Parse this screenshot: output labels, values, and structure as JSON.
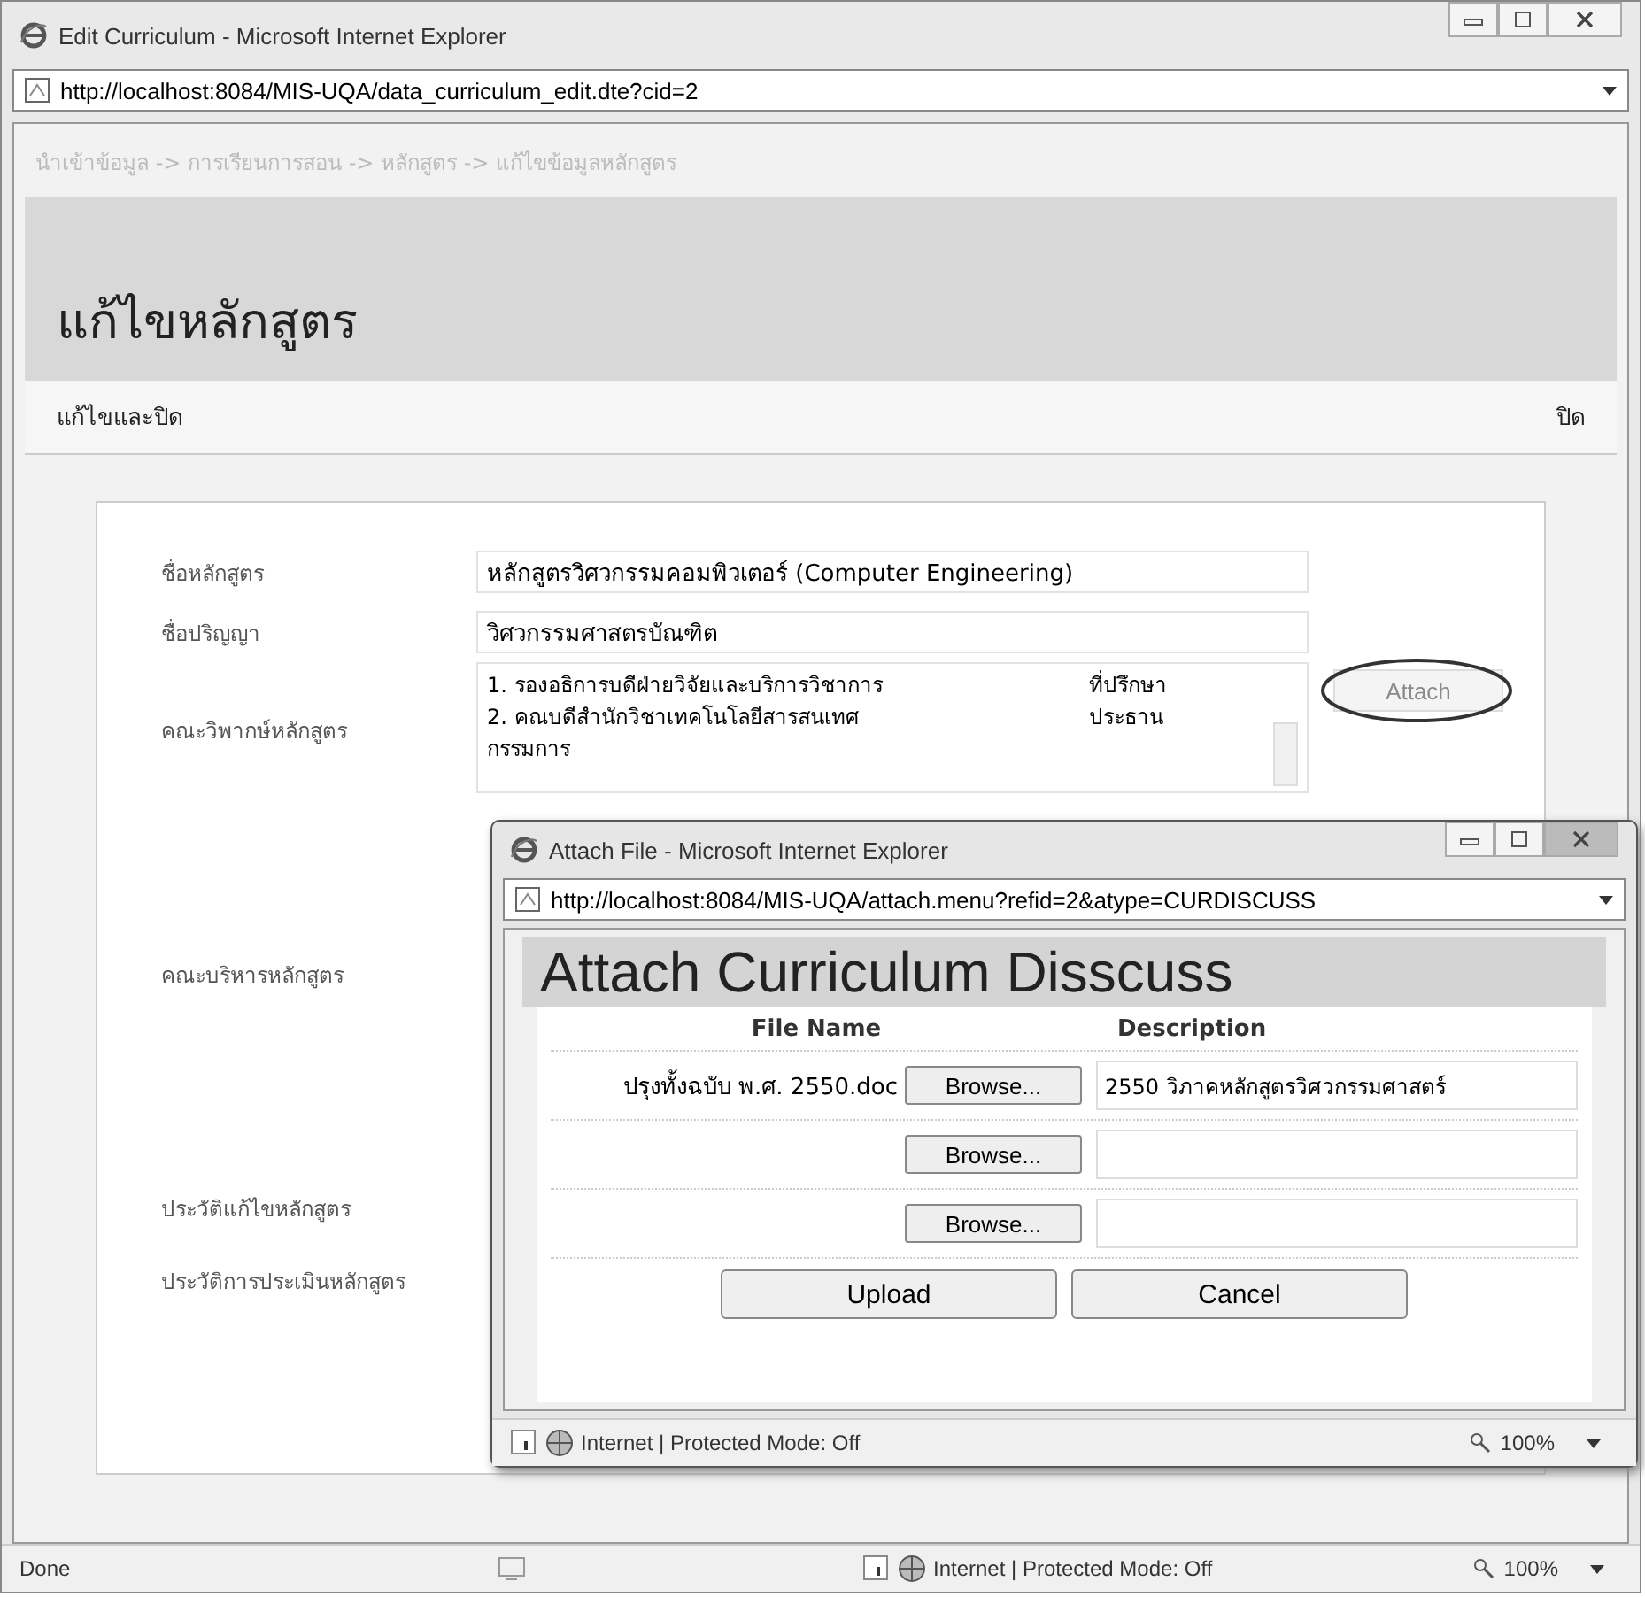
{
  "window": {
    "title": "Edit Curriculum - Microsoft Internet Explorer",
    "address": "http://localhost:8084/MIS-UQA/data_curriculum_edit.dte?cid=2"
  },
  "breadcrumb": "นำเข้าข้อมูล -> การเรียนการสอน -> หลักสูตร -> แก้ไขข้อมูลหลักสูตร",
  "page_title": "แก้ไขหลักสูตร",
  "toolbar": {
    "left": "แก้ไขและปิด",
    "right": "ปิด"
  },
  "form": {
    "fields": [
      {
        "label": "ชื่อหลักสูตร",
        "kind": "text",
        "value": "หลักสูตรวิศวกรรมคอมพิวเตอร์ (Computer Engineering)"
      },
      {
        "label": "ชื่อปริญญา",
        "kind": "text",
        "value": "วิศวกรรมศาสตรบัณฑิต"
      },
      {
        "label": "คณะวิพากษ์หลักสูตร",
        "kind": "list",
        "lines": [
          {
            "text": "1.  รองอธิการบดีฝ่ายวิจัยและบริการวิชาการ",
            "role": "ที่ปรึกษา"
          },
          {
            "text": "2.  คณบดีสำนักวิชาเทคโนโลยีสารสนเทศ",
            "role": "ประธาน"
          },
          {
            "text": "กรรมการ"
          }
        ],
        "attach": {
          "label": "Attach",
          "disabled": true,
          "circled": true
        }
      },
      {
        "label": "คณะบริหารหลักสูตร",
        "kind": "covered"
      },
      {
        "label": "ประวัติแก้ไขหลักสูตร",
        "kind": "covered"
      },
      {
        "label": "ประวัติการประเมินหลักสูตร",
        "kind": "covered"
      }
    ]
  },
  "popup": {
    "title": "Attach File - Microsoft Internet Explorer",
    "address": "http://localhost:8084/MIS-UQA/attach.menu?refid=2&atype=CURDISCUSS",
    "heading": "Attach Curriculum Disscuss",
    "columns": [
      "File Name",
      "Description"
    ],
    "rows": [
      {
        "file": "ปรุงทั้งฉบับ พ.ศ. 2550.doc",
        "browse": "Browse...",
        "description": "2550 วิภาคหลักสูตรวิศวกรรมศาสตร์"
      },
      {
        "browse": "Browse..."
      },
      {
        "browse": "Browse..."
      }
    ],
    "buttons": [
      "Upload",
      "Cancel"
    ],
    "status_bar": {
      "zone": "Internet | Protected Mode: Off",
      "zoom": "100%"
    }
  },
  "status_bar": {
    "text": "Done",
    "zone": "Internet | Protected Mode: Off",
    "zoom": "100%"
  }
}
